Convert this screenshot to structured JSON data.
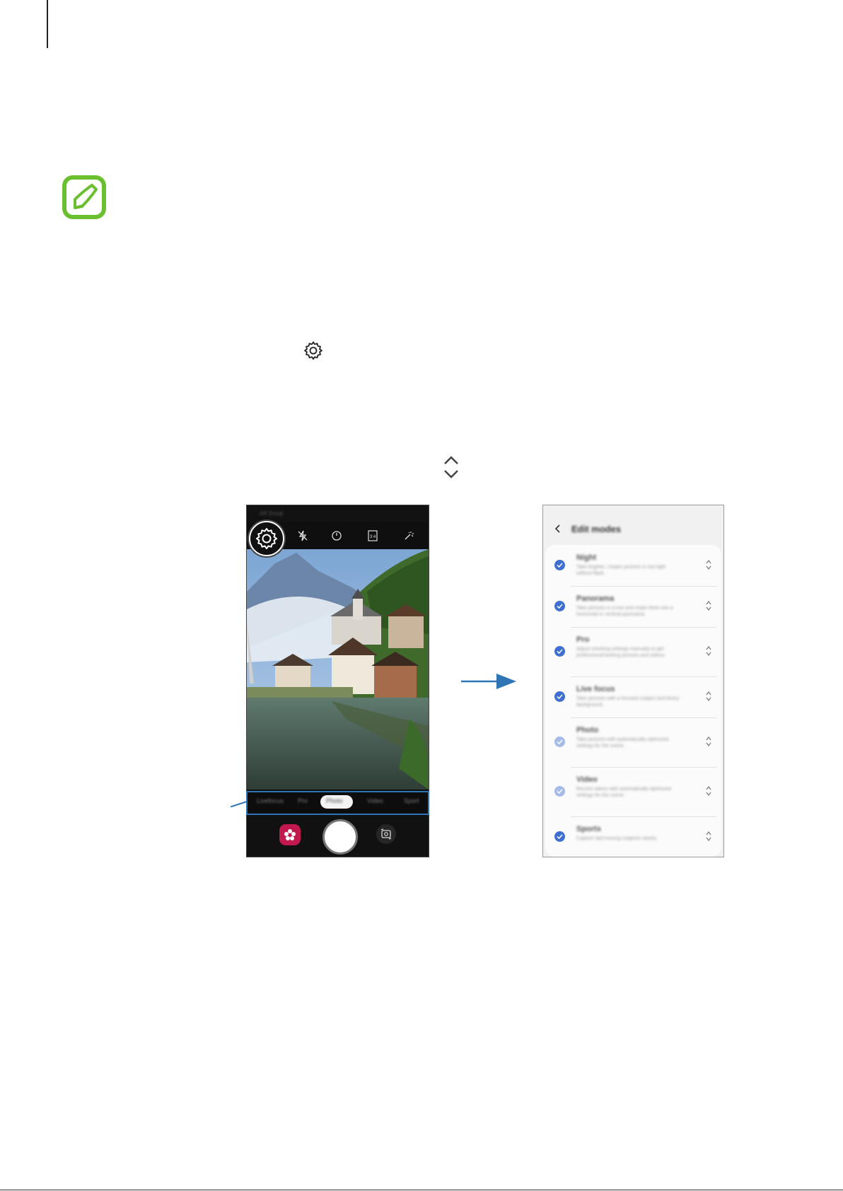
{
  "camera_screen": {
    "status_text": "AR Emoji",
    "toolbar_icons": [
      "settings-icon",
      "flash-off-icon",
      "timer-off-icon",
      "ratio-3-4-icon",
      "effects-icon"
    ],
    "ratio_label": "3:4",
    "modes": [
      "Livefocus",
      "Pro",
      "Photo",
      "Video",
      "Sport"
    ],
    "selected_mode": "Photo"
  },
  "edit_modes_screen": {
    "title": "Edit modes",
    "modes": [
      {
        "name": "Night",
        "description": "Take brighter, crisper pictures in low light without flash.",
        "checked": true
      },
      {
        "name": "Panorama",
        "description": "Take pictures in a line and make them into a horizontal or vertical panorama.",
        "checked": true
      },
      {
        "name": "Pro",
        "description": "Adjust shooting settings manually to get professional-looking pictures and videos.",
        "checked": true
      },
      {
        "name": "Live focus",
        "description": "Take pictures with a focused subject and blurry background.",
        "checked": true
      },
      {
        "name": "Photo",
        "description": "Take pictures with automatically optimized settings for the scene.",
        "checked": true,
        "locked": true
      },
      {
        "name": "Video",
        "description": "Record videos with automatically optimized settings for the scene.",
        "checked": true,
        "locked": true
      },
      {
        "name": "Sports",
        "description": "Capture fast-moving subjects clearly.",
        "checked": true
      }
    ]
  },
  "colors": {
    "note_icon": "#6abf2e",
    "highlight": "#2e75b6",
    "check": "#3f6fd0"
  }
}
